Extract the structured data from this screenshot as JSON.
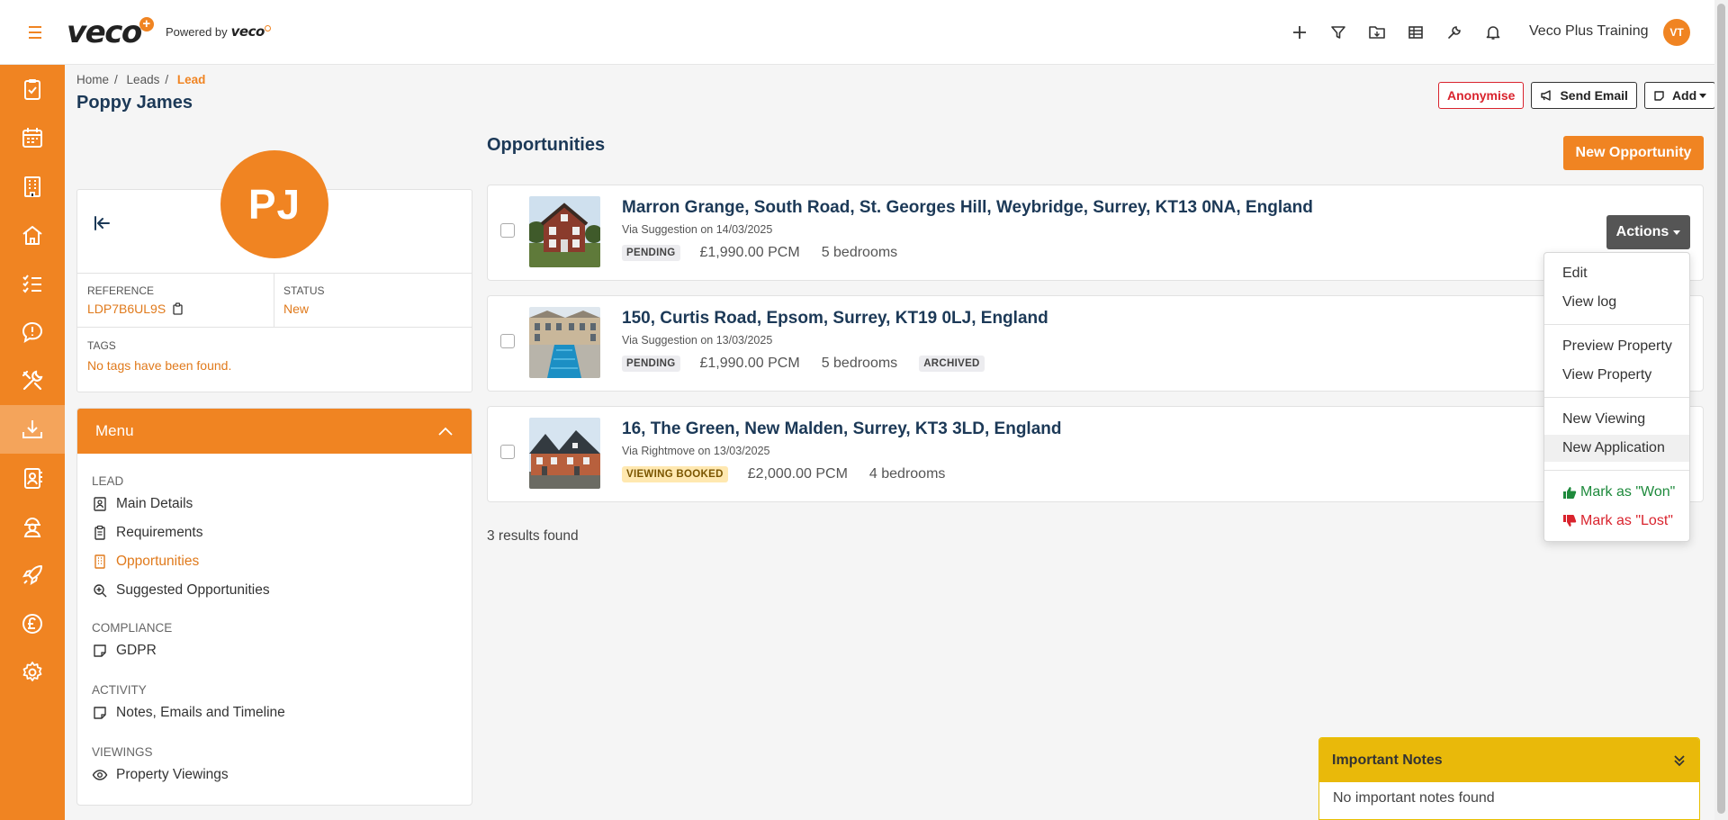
{
  "topbar": {
    "logo": "veco",
    "powered_by_label": "Powered by",
    "powered_by_logo": "veco",
    "icons": [
      "plus-icon",
      "filter-icon",
      "folder-download-icon",
      "table-icon",
      "wrench-icon",
      "bell-icon"
    ],
    "user_name": "Veco Plus Training",
    "user_initials": "VT"
  },
  "sidebar": {
    "items": [
      "tasks-icon",
      "calendar-icon",
      "building-icon",
      "home-icon",
      "checklist-icon",
      "chat-alert-icon",
      "tools-icon",
      "inbox-download-icon",
      "contact-book-icon",
      "worker-icon",
      "rocket-icon",
      "pound-icon",
      "settings-icon"
    ],
    "active_index": 7
  },
  "breadcrumb": {
    "home": "Home",
    "leads": "Leads",
    "current": "Lead",
    "separator": "/"
  },
  "page_title": "Poppy James",
  "header_buttons": {
    "anonymise": "Anonymise",
    "send_email": "Send Email",
    "add": "Add"
  },
  "lead": {
    "initials": "PJ",
    "reference_label": "REFERENCE",
    "reference": "LDP7B6UL9S",
    "status_label": "STATUS",
    "status": "New",
    "tags_label": "TAGS",
    "tags_empty": "No tags have been found."
  },
  "menu": {
    "title": "Menu",
    "sections": {
      "lead": "LEAD",
      "compliance": "COMPLIANCE",
      "activity": "ACTIVITY",
      "viewings": "VIEWINGS"
    },
    "items": {
      "main_details": "Main Details",
      "requirements": "Requirements",
      "opportunities": "Opportunities",
      "suggested": "Suggested Opportunities",
      "gdpr": "GDPR",
      "notes": "Notes, Emails and Timeline",
      "property_viewings": "Property Viewings"
    }
  },
  "opportunities": {
    "title": "Opportunities",
    "new_button": "New Opportunity",
    "actions_label": "Actions",
    "results": "3 results found",
    "list": [
      {
        "title": "Marron Grange, South Road, St. Georges Hill, Weybridge, Surrey, KT13 0NA, England",
        "source": "Via Suggestion on 14/03/2025",
        "status": "PENDING",
        "price": "£1,990.00 PCM",
        "bedrooms": "5 bedrooms",
        "extra_badge": ""
      },
      {
        "title": "150, Curtis Road, Epsom, Surrey, KT19 0LJ, England",
        "source": "Via Suggestion on 13/03/2025",
        "status": "PENDING",
        "price": "£1,990.00 PCM",
        "bedrooms": "5 bedrooms",
        "extra_badge": "ARCHIVED"
      },
      {
        "title": "16, The Green, New Malden, Surrey, KT3 3LD, England",
        "source": "Via Rightmove on 13/03/2025",
        "status": "VIEWING BOOKED",
        "price": "£2,000.00 PCM",
        "bedrooms": "4 bedrooms",
        "extra_badge": ""
      }
    ]
  },
  "actions_menu": {
    "edit": "Edit",
    "view_log": "View log",
    "preview_property": "Preview Property",
    "view_property": "View Property",
    "new_viewing": "New Viewing",
    "new_application": "New Application",
    "mark_won": "Mark as \"Won\"",
    "mark_lost": "Mark as \"Lost\""
  },
  "important_notes": {
    "title": "Important Notes",
    "empty": "No important notes found"
  },
  "colors": {
    "brand_orange": "#f08422",
    "title_navy": "#1c3957",
    "danger": "#d9232d",
    "success": "#1e8a3c",
    "notes_yellow": "#e9b90a"
  }
}
